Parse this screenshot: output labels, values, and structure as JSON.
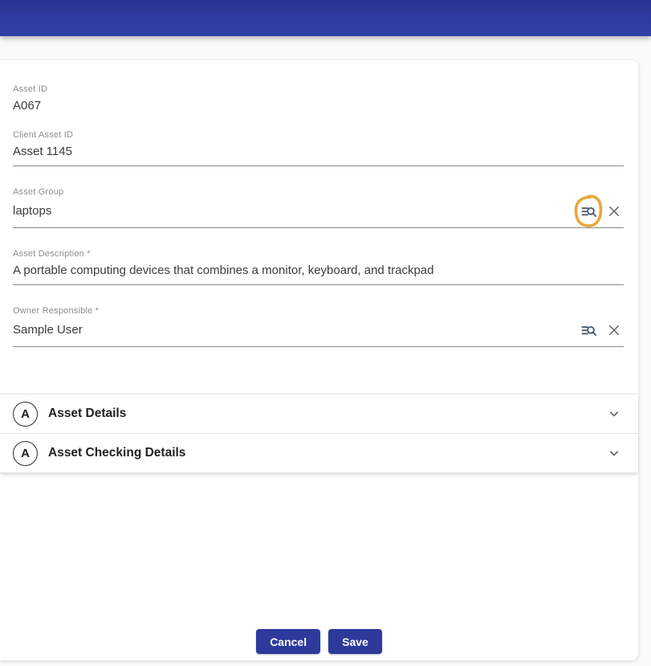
{
  "appbar": {
    "title": ""
  },
  "colors": {
    "primary": "#2d3a9c",
    "header_gradient_top": "#2a338f",
    "header_gradient_bottom": "#3040a6",
    "annotation_circle": "#e9a73c",
    "field_label": "#8c8c8c",
    "field_value": "#3b3b3b",
    "underline": "#8a8a8a"
  },
  "form": {
    "fields": {
      "asset_id": {
        "label": "Asset ID",
        "value": "A067"
      },
      "client_asset_id": {
        "label": "Client Asset ID",
        "value": "Asset 1145"
      },
      "asset_group": {
        "label": "Asset Group",
        "value": "laptops"
      },
      "asset_description": {
        "label": "Asset Description *",
        "value": "A portable computing devices that combines a monitor, keyboard, and trackpad"
      },
      "owner_responsible": {
        "label": "Owner Responsible *",
        "value": "Sample User"
      }
    },
    "icons": {
      "lookup": "manage-search-icon",
      "clear": "clear-x-icon"
    }
  },
  "sections": {
    "asset_details": {
      "icon_letter": "A",
      "title": "Asset Details"
    },
    "asset_checking_details": {
      "icon_letter": "A",
      "title": "Asset Checking Details"
    }
  },
  "actions": {
    "cancel_label": "Cancel",
    "save_label": "Save"
  }
}
